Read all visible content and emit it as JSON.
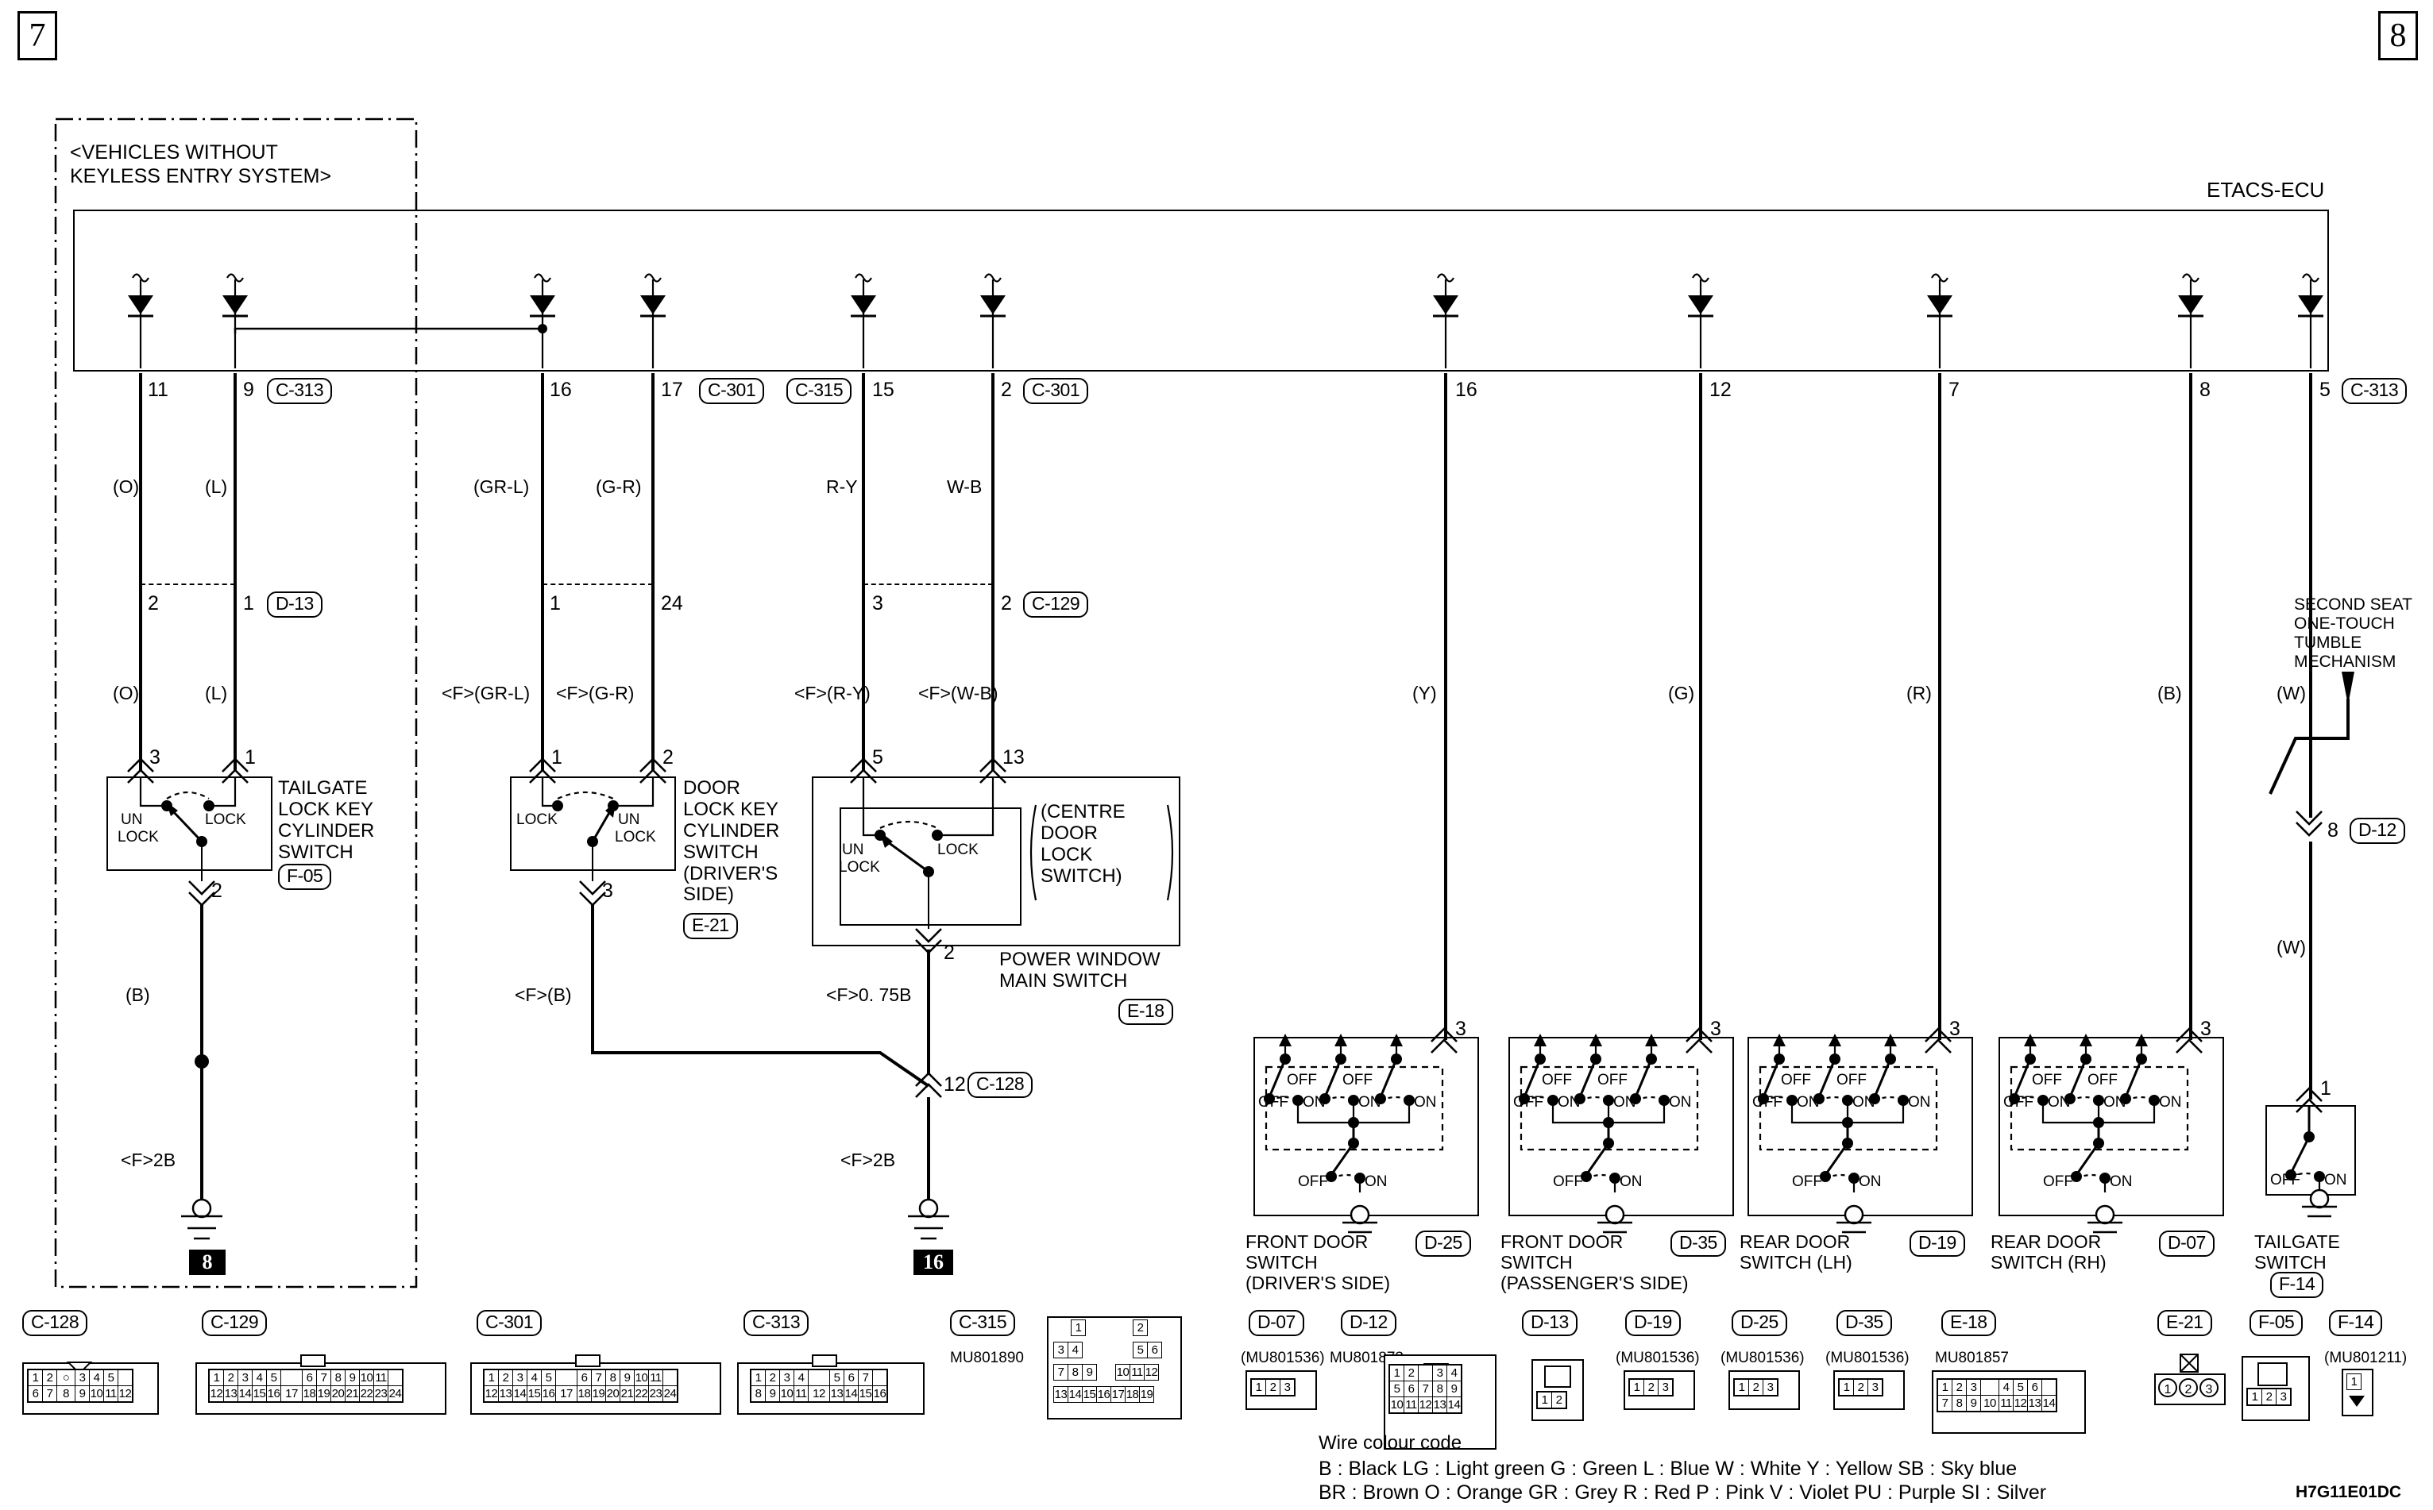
{
  "page": {
    "left_page_number": "7",
    "right_page_number": "8",
    "drawing_code": "H7G11E01DC",
    "variant_note_line1": "<VEHICLES WITHOUT",
    "variant_note_line2": " KEYLESS ENTRY SYSTEM>",
    "ecu_label": "ETACS-ECU"
  },
  "left_branch": {
    "wires": [
      {
        "top_pin": "11",
        "wire_colour": "(O)",
        "mid_pin": "2",
        "lower_colour": "(O)",
        "bottom_pin": "3"
      },
      {
        "top_pin": "9",
        "wire_colour": "(L)",
        "mid_pin": "1",
        "lower_colour": "(L)",
        "bottom_pin": "1"
      }
    ],
    "top_connector": "C-313",
    "mid_connector": "D-13",
    "component": {
      "name_lines": [
        "TAILGATE",
        "LOCK KEY",
        "CYLINDER",
        "SWITCH"
      ],
      "connector": "F-05",
      "contact_left": "UN\nLOCK",
      "contact_right": "LOCK",
      "out_pin": "2"
    },
    "ground_wire_colour": "(B)",
    "ground_spec": "<F>2B",
    "ground_ref": "8"
  },
  "mid_branch": {
    "wires": [
      {
        "top_pin": "16",
        "wire_colour": "(GR-L)",
        "mid_pin": "1",
        "lower_colour": "<F>(GR-L)",
        "bottom_pin": "1"
      },
      {
        "top_pin": "17",
        "wire_colour": "(G-R)",
        "mid_pin": "24",
        "lower_colour": "<F>(G-R)",
        "bottom_pin": "2"
      }
    ],
    "top_connector": "C-301",
    "component": {
      "name_lines": [
        "DOOR",
        "LOCK KEY",
        "CYLINDER",
        "SWITCH",
        "(DRIVER'S",
        "SIDE)"
      ],
      "connector": "E-21",
      "contact_left": "LOCK",
      "contact_right": "UN\nLOCK",
      "out_pin": "3"
    },
    "ground_spec": "<F>(B)"
  },
  "right_branch": {
    "wires": [
      {
        "top_pin": "15",
        "wire_colour": "R-Y",
        "mid_pin": "3",
        "lower_colour": "<F>(R-Y)",
        "bottom_pin": "5"
      },
      {
        "top_pin": "2",
        "wire_colour": "W-B",
        "mid_pin": "2",
        "lower_colour": "<F>(W-B)",
        "bottom_pin": "13"
      }
    ],
    "top_connector_left": "C-315",
    "top_connector_right": "C-301",
    "mid_connector": "C-129",
    "component": {
      "inner_lines": [
        "(CENTRE",
        "DOOR",
        "LOCK",
        "SWITCH)"
      ],
      "outer_lines": [
        "POWER WINDOW",
        "MAIN SWITCH"
      ],
      "connector": "E-18",
      "contact_left": "UN\nLOCK",
      "contact_right": "LOCK",
      "out_pin": "2"
    },
    "ground_spec_upper": "<F>0. 75B",
    "splice_pin": "12",
    "splice_connector": "C-128",
    "ground_spec": "<F>2B",
    "ground_ref": "16"
  },
  "door_switches": {
    "wires": [
      {
        "top_pin": "16",
        "colour": "(Y)",
        "bottom_pin": "3"
      },
      {
        "top_pin": "12",
        "colour": "(G)",
        "bottom_pin": "3"
      },
      {
        "top_pin": "7",
        "colour": "(R)",
        "bottom_pin": "3"
      },
      {
        "top_pin": "8",
        "colour": "(B)",
        "bottom_pin": "3"
      }
    ],
    "items": [
      {
        "title_lines": [
          "FRONT DOOR",
          "SWITCH",
          "(DRIVER'S SIDE)"
        ],
        "connector": "D-25"
      },
      {
        "title_lines": [
          "FRONT DOOR",
          "SWITCH",
          "(PASSENGER'S SIDE)"
        ],
        "connector": "D-35"
      },
      {
        "title_lines": [
          "REAR DOOR",
          "SWITCH (LH)"
        ],
        "connector": "D-19"
      },
      {
        "title_lines": [
          "REAR DOOR",
          "SWITCH (RH)"
        ],
        "connector": "D-07"
      }
    ],
    "switch_states": {
      "off": "OFF",
      "on": "ON"
    }
  },
  "tailgate_branch": {
    "top_pin": "5",
    "top_connector": "C-313",
    "note_lines": [
      "SECOND SEAT",
      "ONE-TOUCH",
      "TUMBLE",
      "MECHANISM"
    ],
    "upper_colour": "(W)",
    "mid_pin": "8",
    "mid_connector": "D-12",
    "lower_colour": "(W)",
    "bottom_pin": "1",
    "title_lines": [
      "TAILGATE",
      "SWITCH"
    ],
    "connector": "F-14",
    "state_off": "OFF",
    "state_on": "ON"
  },
  "connector_views": [
    {
      "id": "C-128",
      "part": "",
      "rows": [
        [
          "1",
          "2",
          "O",
          "3",
          "4",
          "5"
        ],
        [
          "6",
          "7",
          "8",
          "9",
          "10",
          "11",
          "12"
        ]
      ]
    },
    {
      "id": "C-129",
      "part": "",
      "rows": [
        [
          "1",
          "2",
          "3",
          "4",
          "5",
          "",
          "6",
          "7",
          "8",
          "9",
          "10",
          "11"
        ],
        [
          "12",
          "13",
          "14",
          "15",
          "16",
          "17",
          "18",
          "19",
          "20",
          "21",
          "22",
          "23",
          "24"
        ]
      ]
    },
    {
      "id": "C-301",
      "part": "",
      "rows": [
        [
          "1",
          "2",
          "3",
          "4",
          "5",
          "",
          "6",
          "7",
          "8",
          "9",
          "10",
          "11"
        ],
        [
          "12",
          "13",
          "14",
          "15",
          "16",
          "17",
          "18",
          "19",
          "20",
          "21",
          "22",
          "23",
          "24"
        ]
      ]
    },
    {
      "id": "C-313",
      "part": "",
      "rows": [
        [
          "1",
          "2",
          "3",
          "4",
          "",
          "5",
          "6",
          "7"
        ],
        [
          "8",
          "9",
          "10",
          "11",
          "12",
          "13",
          "14",
          "15",
          "16"
        ]
      ]
    },
    {
      "id": "C-315",
      "part": "MU801890",
      "rows": [
        [
          "1",
          "2"
        ],
        [
          "3",
          "4",
          "5",
          "6"
        ],
        [
          "7",
          "8",
          "9",
          "10",
          "11",
          "12"
        ],
        [
          "13",
          "14",
          "15",
          "16",
          "17",
          "18",
          "19"
        ]
      ]
    },
    {
      "id": "D-07",
      "part": "(MU801536)",
      "rows": [
        [
          "1",
          "2",
          "3"
        ]
      ]
    },
    {
      "id": "D-12",
      "part": "MU801873",
      "rows": [
        [
          "1",
          "2",
          "",
          "3",
          "4"
        ],
        [
          "5",
          "6",
          "7",
          "8",
          "9"
        ],
        [
          "10",
          "11",
          "12",
          "13",
          "14"
        ]
      ]
    },
    {
      "id": "D-13",
      "part": "",
      "rows": [
        [
          "1",
          "2"
        ]
      ]
    },
    {
      "id": "D-19",
      "part": "(MU801536)",
      "rows": [
        [
          "1",
          "2",
          "3"
        ]
      ]
    },
    {
      "id": "D-25",
      "part": "(MU801536)",
      "rows": [
        [
          "1",
          "2",
          "3"
        ]
      ]
    },
    {
      "id": "D-35",
      "part": "(MU801536)",
      "rows": [
        [
          "1",
          "2",
          "3"
        ]
      ]
    },
    {
      "id": "E-18",
      "part": "MU801857",
      "rows": [
        [
          "1",
          "2",
          "3",
          "",
          "4",
          "5",
          "6"
        ],
        [
          "7",
          "8",
          "9",
          "10",
          "11",
          "12",
          "13",
          "14"
        ]
      ]
    },
    {
      "id": "E-21",
      "part": "",
      "rows": [
        [
          "1",
          "2",
          "3"
        ]
      ]
    },
    {
      "id": "F-05",
      "part": "",
      "rows": [
        [
          "1",
          "2",
          "3"
        ]
      ]
    },
    {
      "id": "F-14",
      "part": "(MU801211)",
      "rows": [
        [
          "1"
        ]
      ]
    }
  ],
  "wire_colour_code": {
    "heading": "Wire colour code",
    "row1": [
      {
        "abbr": "B",
        "name": "Black"
      },
      {
        "abbr": "LG",
        "name": "Light green"
      },
      {
        "abbr": "G",
        "name": "Green"
      },
      {
        "abbr": "L",
        "name": "Blue"
      },
      {
        "abbr": "W",
        "name": "White"
      },
      {
        "abbr": "Y",
        "name": "Yellow"
      },
      {
        "abbr": "SB",
        "name": "Sky blue"
      }
    ],
    "row2": [
      {
        "abbr": "BR",
        "name": "Brown"
      },
      {
        "abbr": "O",
        "name": "Orange"
      },
      {
        "abbr": "GR",
        "name": "Grey"
      },
      {
        "abbr": "R",
        "name": "Red"
      },
      {
        "abbr": "P",
        "name": "Pink"
      },
      {
        "abbr": "V",
        "name": "Violet"
      },
      {
        "abbr": "PU",
        "name": "Purple"
      },
      {
        "abbr": "SI",
        "name": "Silver"
      }
    ],
    "row1_text": "B : Black    LG : Light green    G : Green    L : Blue    W : White    Y : Yellow    SB : Sky blue",
    "row2_text": "BR : Brown    O : Orange    GR : Grey    R : Red    P : Pink    V : Violet    PU : Purple    SI : Silver"
  }
}
